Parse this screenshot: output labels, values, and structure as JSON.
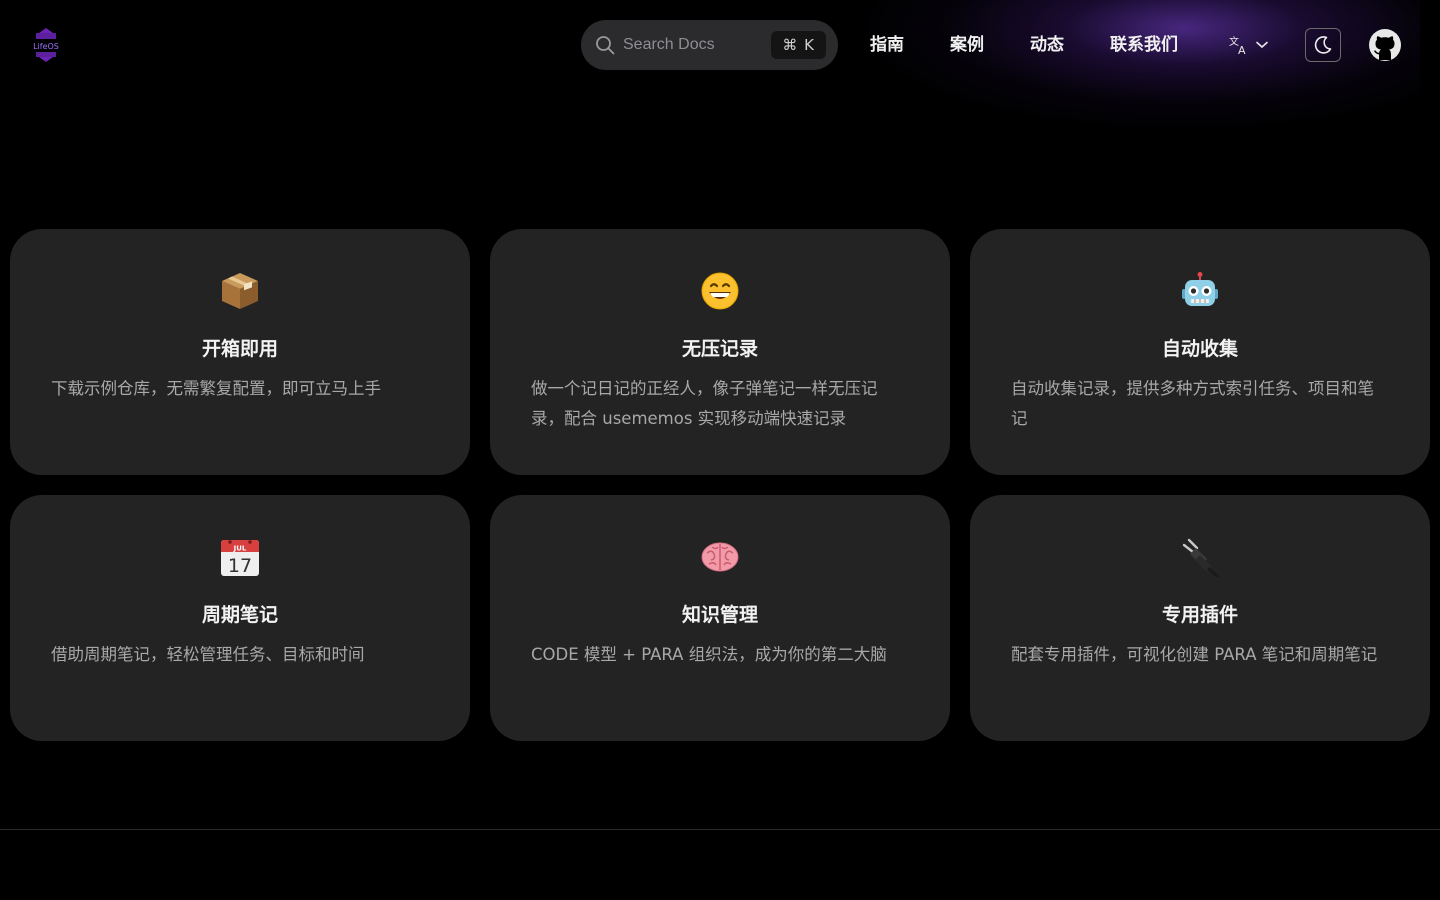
{
  "header": {
    "logo_text": "LifeOS",
    "search": {
      "placeholder": "Search Docs",
      "shortcut": "⌘ K"
    },
    "nav": [
      {
        "label": "指南"
      },
      {
        "label": "案例"
      },
      {
        "label": "动态"
      },
      {
        "label": "联系我们"
      }
    ],
    "language_icon": "translate-icon",
    "theme_icon": "moon-icon",
    "github_icon": "github-icon"
  },
  "features": [
    {
      "emoji": "package",
      "title": "开箱即用",
      "desc": "下载示例仓库，无需繁复配置，即可立马上手"
    },
    {
      "emoji": "grinning-face",
      "title": "无压记录",
      "desc": "做一个记日记的正经人，像子弹笔记一样无压记录，配合 usememos 实现移动端快速记录"
    },
    {
      "emoji": "robot",
      "title": "自动收集",
      "desc": "自动收集记录，提供多种方式索引任务、项目和笔记"
    },
    {
      "emoji": "calendar",
      "title": "周期笔记",
      "desc": "借助周期笔记，轻松管理任务、目标和时间"
    },
    {
      "emoji": "brain",
      "title": "知识管理",
      "desc": "CODE 模型 + PARA 组织法，成为你的第二大脑"
    },
    {
      "emoji": "electric-plug",
      "title": "专用插件",
      "desc": "配套专用插件，可视化创建 PARA 笔记和周期笔记"
    }
  ],
  "colors": {
    "background": "#000000",
    "card": "#232323",
    "accent": "#7b3fe4"
  }
}
